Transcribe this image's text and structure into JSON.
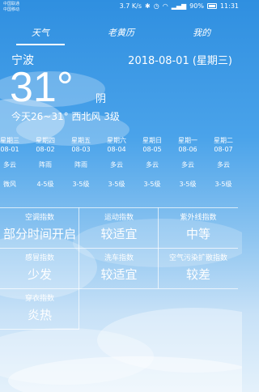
{
  "status": {
    "carrier_line1": "中国联通",
    "carrier_line2": "中国移动",
    "speed": "3.7 K/s",
    "battery": "90%",
    "time": "11:31"
  },
  "tabs": [
    {
      "label": "天气"
    },
    {
      "label": "老黄历"
    },
    {
      "label": "我的"
    }
  ],
  "current": {
    "city": "宁波",
    "date": "2018-08-01 (星期三)",
    "temperature": "31°",
    "condition": "阴",
    "today_summary": "今天26~31° 西北风 3级"
  },
  "forecast": [
    {
      "day": "星期三",
      "date": "08-01",
      "weather": "多云",
      "wind": "微风"
    },
    {
      "day": "星期四",
      "date": "08-02",
      "weather": "阵雨",
      "wind": "4-5级"
    },
    {
      "day": "星期五",
      "date": "08-03",
      "weather": "阵雨",
      "wind": "3-5级"
    },
    {
      "day": "星期六",
      "date": "08-04",
      "weather": "多云",
      "wind": "3-5级"
    },
    {
      "day": "星期日",
      "date": "08-05",
      "weather": "多云",
      "wind": "3-5级"
    },
    {
      "day": "星期一",
      "date": "08-06",
      "weather": "多云",
      "wind": "3-5级"
    },
    {
      "day": "星期二",
      "date": "08-07",
      "weather": "多云",
      "wind": "3-5级"
    }
  ],
  "indices": [
    {
      "title": "空调指数",
      "value": "部分时间开启"
    },
    {
      "title": "运动指数",
      "value": "较适宜"
    },
    {
      "title": "紫外线指数",
      "value": "中等"
    },
    {
      "title": "感冒指数",
      "value": "少发"
    },
    {
      "title": "洗车指数",
      "value": "较适宜"
    },
    {
      "title": "空气污染扩散指数",
      "value": "较差"
    },
    {
      "title": "穿衣指数",
      "value": "炎热"
    }
  ]
}
